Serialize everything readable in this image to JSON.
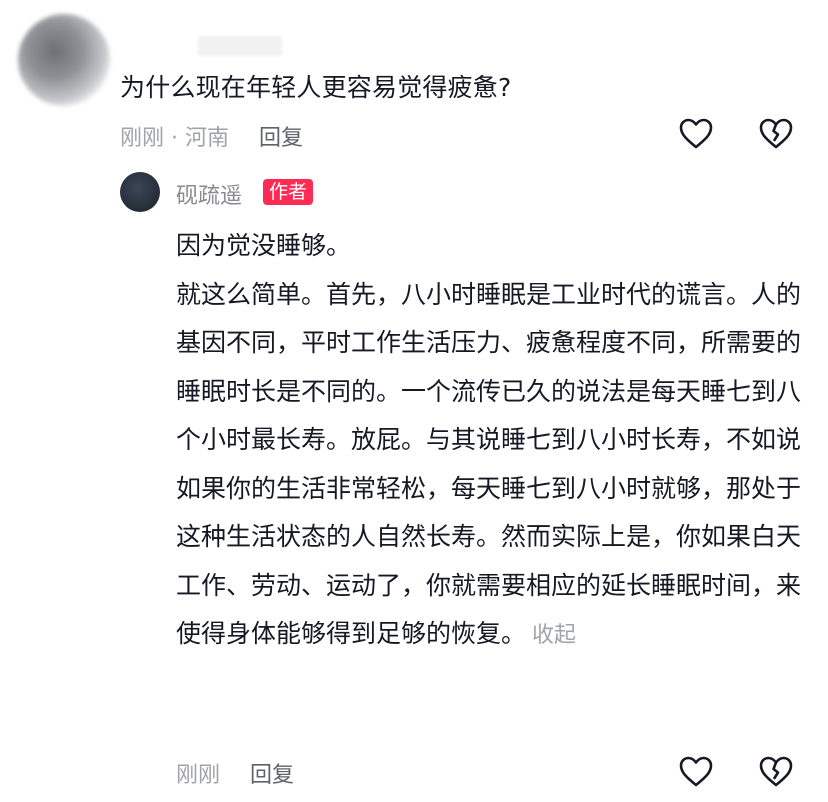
{
  "comment": {
    "question": "为什么现在年轻人更容易觉得疲惫?",
    "time_location": "刚刚 · 河南",
    "reply_label": "回复"
  },
  "reply": {
    "author": "砚疏遥",
    "badge": "作者",
    "paragraphs": [
      "因为觉没睡够。",
      "就这么简单。首先，八小时睡眠是工业时代的谎言。人的基因不同，平时工作生活压力、疲惫程度不同，所需要的睡眠时长是不同的。一个流传已久的说法是每天睡七到八个小时最长寿。放屁。与其说睡七到八小时长寿，不如说如果你的生活非常轻松，每天睡七到八小时就够，那处于这种生活状态的人自然长寿。然而实际上是，你如果白天工作、劳动、运动了，你就需要相应的延长睡眠时间，来使得身体能够得到足够的恢复。"
    ],
    "collapse_label": "收起",
    "time": "刚刚",
    "reply_label": "回复"
  },
  "icons": {
    "like": "heart-outline-icon",
    "dislike": "broken-heart-icon"
  },
  "colors": {
    "text": "#161823",
    "meta": "#a2a3a8",
    "badge": "#fe2c55"
  }
}
